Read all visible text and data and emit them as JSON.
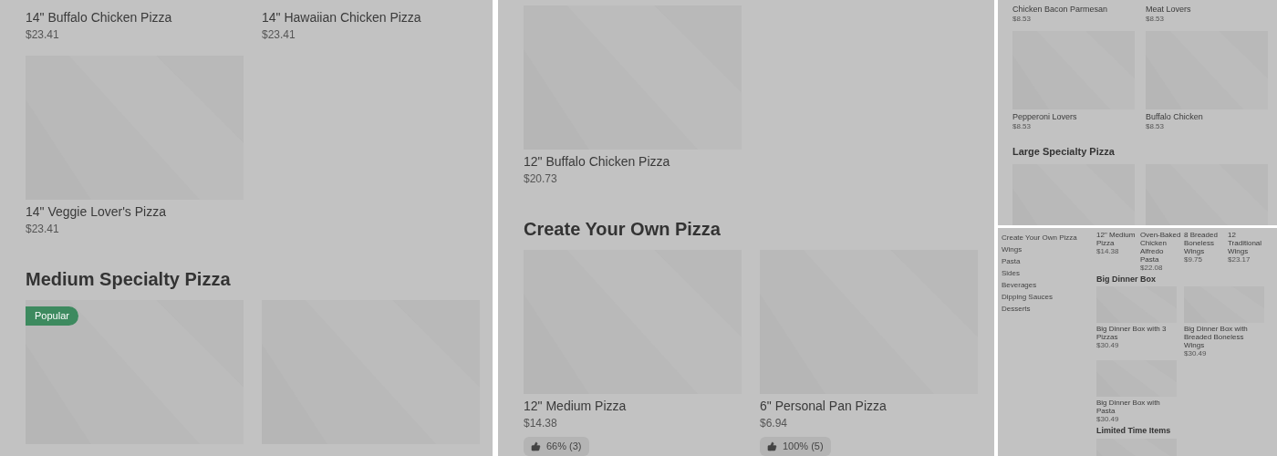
{
  "panels": [
    {
      "kind": "page",
      "sections": [
        {
          "items": [
            {
              "name": "14\" Buffalo Chicken Pizza",
              "price": "$23.41",
              "image": false
            },
            {
              "name": "14\" Hawaiian Chicken Pizza",
              "price": "$23.41",
              "image": false
            }
          ]
        },
        {
          "items": [
            {
              "name": "14\" Veggie Lover's Pizza",
              "price": "$23.41",
              "image": true
            }
          ]
        },
        {
          "heading": "Medium Specialty Pizza",
          "items": [
            {
              "badge": "Popular",
              "image": true
            },
            {
              "image": true
            }
          ]
        }
      ]
    },
    {
      "kind": "page",
      "sections": [
        {
          "items": [
            {
              "name": "12\" Buffalo Chicken Pizza",
              "price": "$20.73",
              "image": true
            }
          ]
        },
        {
          "heading": "Create Your Own Pizza",
          "items": [
            {
              "name": "12\" Medium Pizza",
              "price": "$14.38",
              "rating": "66% (3)",
              "image": true
            },
            {
              "name": "6\" Personal Pan Pizza",
              "price": "$6.94",
              "rating": "100% (5)",
              "image": true
            }
          ]
        }
      ]
    },
    {
      "kind": "overview",
      "sections": [
        {
          "items": [
            {
              "name": "Chicken Bacon Parmesan",
              "price": "$8.53",
              "image": false
            },
            {
              "name": "Meat Lovers",
              "price": "$8.53",
              "image": false
            }
          ]
        },
        {
          "items": [
            {
              "name": "Pepperoni Lovers",
              "price": "$8.53",
              "image": true
            },
            {
              "name": "Buffalo Chicken",
              "price": "$8.53",
              "image": true
            }
          ]
        },
        {
          "heading": "Large Specialty Pizza",
          "items": [
            {
              "image": true
            },
            {
              "image": true
            }
          ]
        }
      ]
    },
    {
      "kind": "overview-nav",
      "nav": [
        "Create Your Own Pizza",
        "Wings",
        "Pasta",
        "Sides",
        "Beverages",
        "Dipping Sauces",
        "Desserts"
      ],
      "sections": [
        {
          "items": [
            {
              "name": "12\" Medium Pizza",
              "price": "$14.38",
              "image": false
            },
            {
              "name": "Oven-Baked Chicken Alfredo Pasta",
              "price": "$22.08",
              "image": false
            },
            {
              "name": "8 Breaded Boneless Wings",
              "price": "$9.75",
              "image": false
            },
            {
              "name": "12 Traditional Wings",
              "price": "$23.17",
              "image": false
            }
          ]
        },
        {
          "heading": "Big Dinner Box",
          "items": [
            {
              "name": "Big Dinner Box with 3 Pizzas",
              "price": "$30.49",
              "image": true
            },
            {
              "name": "Big Dinner Box with Breaded Boneless Wings",
              "price": "$30.49",
              "image": true
            }
          ]
        },
        {
          "items": [
            {
              "name": "Big Dinner Box with Pasta",
              "price": "$30.49",
              "image": true
            }
          ]
        },
        {
          "heading": "Limited Time Items",
          "items": [
            {
              "image": true
            }
          ]
        }
      ]
    }
  ]
}
